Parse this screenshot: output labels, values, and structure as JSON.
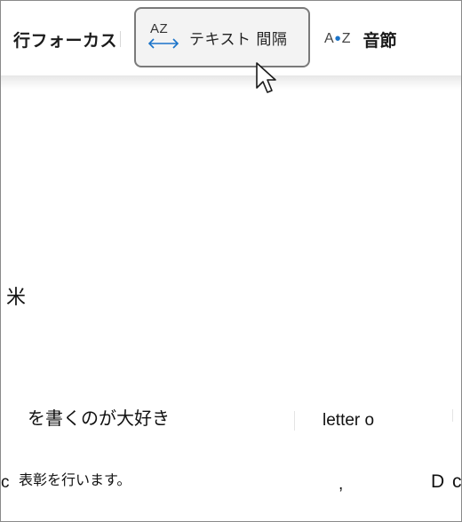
{
  "toolbar": {
    "line_focus_label": "行フォーカス",
    "text_spacing_icon_text": "AZ",
    "text_spacing_label": "テキスト 間隔",
    "syllables_icon_left": "A",
    "syllables_icon_right": "Z",
    "syllables_label": "音節",
    "icons": {
      "text_spacing": "text-spacing-icon",
      "syllables": "syllables-icon",
      "cursor": "mouse-pointer-icon"
    },
    "accent_color": "#1a73c9"
  },
  "content": {
    "rice": "米",
    "love_writing": "を書くのが大好き",
    "letter": "letter o",
    "fragment_c": "c",
    "award": "表彰を行います。",
    "comma": ",",
    "fragment_D": "D",
    "fragment_c2": "c"
  }
}
